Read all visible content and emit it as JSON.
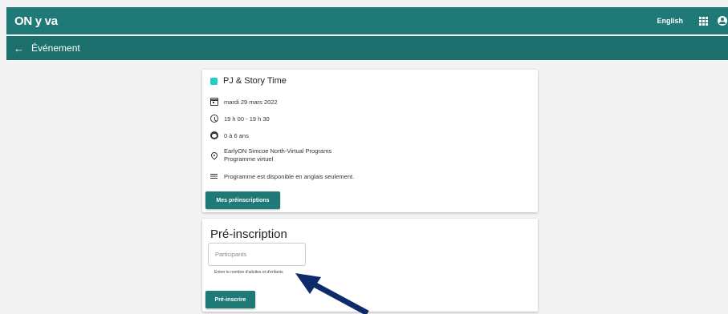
{
  "header": {
    "logo": "ON y va",
    "language": "English",
    "apps_icon": "apps-grid-icon",
    "account_icon": "account-circle-icon",
    "color": "#1f7a77"
  },
  "subheader": {
    "back_icon": "arrow-back-icon",
    "back_glyph": "←",
    "title": "Événement"
  },
  "event": {
    "color": "#1ecfc5",
    "title": "PJ & Story Time",
    "date": "mardi 29 mars 2022",
    "time": "19 h 00 - 19 h 30",
    "ages": "0 à 6 ans",
    "location_line1": "EarlyON Simcoe North-Virtual Programs",
    "location_line2": "Programme virtuel",
    "note": "Programme est disponible en anglais seulement.",
    "button_label": "Mes préinscriptions"
  },
  "registration": {
    "title": "Pré-inscription",
    "participants_placeholder": "Participants",
    "participants_value": "",
    "helper": "Entrer le nombre d'adultes et d'enfants",
    "button_label": "Pré-inscrire"
  },
  "annotation": {
    "arrow_color": "#0d2a6b"
  }
}
